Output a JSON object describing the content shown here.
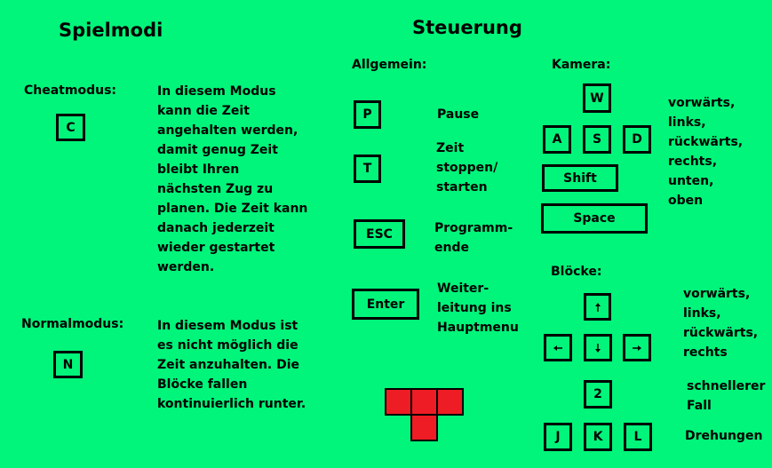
{
  "spielmodi": {
    "title": "Spielmodi",
    "cheat": {
      "label": "Cheatmodus:",
      "key": "C",
      "desc": "In diesem Modus\nkann die Zeit\nangehalten werden,\ndamit genug Zeit\nbleibt Ihren\nnächsten Zug zu\nplanen. Die Zeit kann\ndanach jederzeit\nwieder gestartet\nwerden."
    },
    "normal": {
      "label": "Normalmodus:",
      "key": "N",
      "desc": "In diesem Modus ist\nes nicht möglich die\nZeit anzuhalten. Die\nBlöcke fallen\nkontinuierlich runter."
    }
  },
  "steuerung": {
    "title": "Steuerung",
    "allgemein": {
      "label": "Allgemein:",
      "pause_key": "P",
      "pause_text": "Pause",
      "time_key": "T",
      "time_text": "Zeit\nstoppen/\nstarten",
      "esc_key": "ESC",
      "esc_text": "Programm-\nende",
      "enter_key": "Enter",
      "enter_text": "Weiter-\nleitung ins\nHauptmenu"
    },
    "kamera": {
      "label": "Kamera:",
      "keys": {
        "w": "W",
        "a": "A",
        "s": "S",
        "d": "D",
        "shift": "Shift",
        "space": "Space"
      },
      "text": "vorwärts,\nlinks,\nrückwärts,\nrechts,\nunten,\noben"
    },
    "bloecke": {
      "label": "Blöcke:",
      "arrow_icons": [
        "arrow-up-icon",
        "arrow-left-icon",
        "arrow-down-icon",
        "arrow-right-icon"
      ],
      "move_text": "vorwärts,\nlinks,\nrückwärts,\nrechts",
      "fast_key": "2",
      "fast_text": "schnellerer\nFall",
      "rot_keys": {
        "j": "J",
        "k": "K",
        "l": "L"
      },
      "rot_text": "Drehungen"
    }
  },
  "colors": {
    "background": "#00F57A",
    "block": "#EE1C24",
    "border": "#000000"
  }
}
